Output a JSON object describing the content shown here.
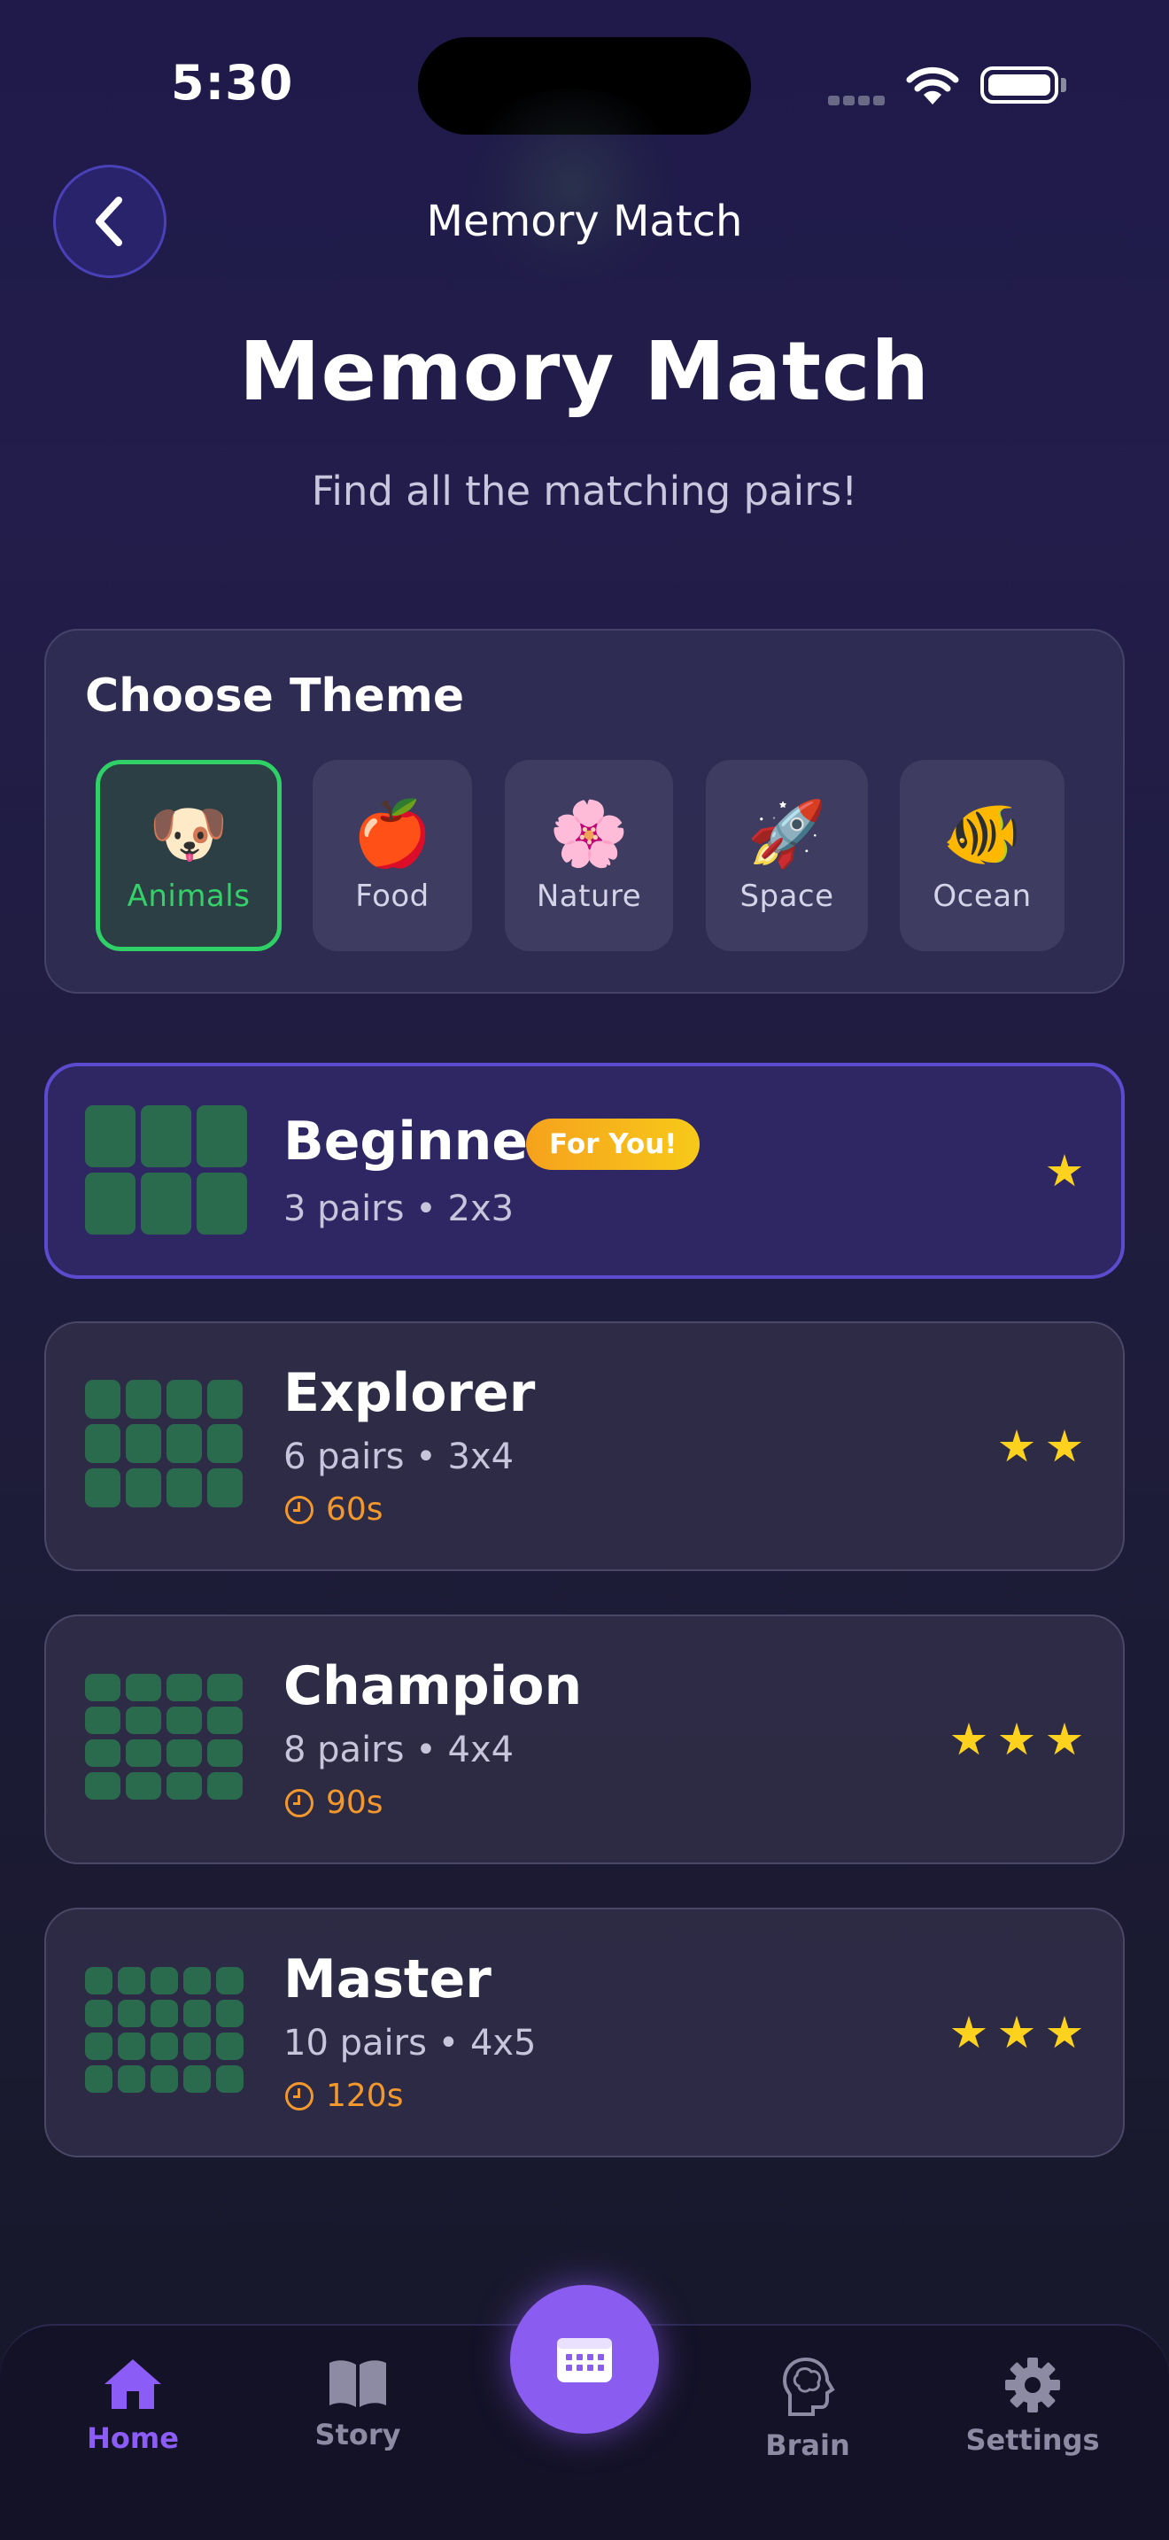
{
  "status_bar": {
    "time": "5:30"
  },
  "header": {
    "nav_title": "Memory Match",
    "title": "Memory Match",
    "subtitle": "Find all the matching pairs!"
  },
  "themes": {
    "heading": "Choose Theme",
    "items": [
      {
        "emoji": "🐶",
        "label": "Animals",
        "selected": true
      },
      {
        "emoji": "🍎",
        "label": "Food",
        "selected": false
      },
      {
        "emoji": "🌸",
        "label": "Nature",
        "selected": false
      },
      {
        "emoji": "🚀",
        "label": "Space",
        "selected": false
      },
      {
        "emoji": "🐠",
        "label": "Ocean",
        "selected": false
      }
    ]
  },
  "levels": [
    {
      "name": "Beginner",
      "meta": "3 pairs • 2x3",
      "badge": "For You!",
      "stars": 1,
      "grid_rows": 2,
      "grid_cols": 3
    },
    {
      "name": "Explorer",
      "meta": "6 pairs • 3x4",
      "time": "60s",
      "stars": 2,
      "grid_rows": 3,
      "grid_cols": 4
    },
    {
      "name": "Champion",
      "meta": "8 pairs • 4x4",
      "time": "90s",
      "stars": 3,
      "grid_rows": 4,
      "grid_cols": 4
    },
    {
      "name": "Master",
      "meta": "10 pairs • 4x5",
      "time": "120s",
      "stars": 3,
      "grid_rows": 4,
      "grid_cols": 5
    }
  ],
  "tabbar": {
    "home": "Home",
    "story": "Story",
    "brain": "Brain",
    "settings": "Settings",
    "center_icon": "calendar-icon"
  },
  "colors": {
    "accent": "#8b5cf6",
    "selected_green": "#2fd167",
    "star": "#fcd21e",
    "timer_orange": "#f2982d",
    "tile_green": "#2a6b4e"
  }
}
